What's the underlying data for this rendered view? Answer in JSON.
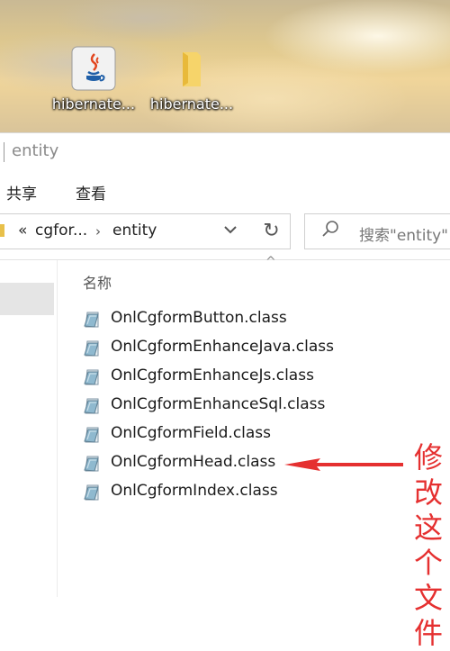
{
  "desktop": {
    "icons": [
      {
        "label": "hibernate...",
        "icon": "java-file-icon"
      },
      {
        "label": "hibernate...",
        "icon": "folder-icon"
      }
    ]
  },
  "window": {
    "title": "entity",
    "ribbon_tabs": [
      "共享",
      "查看"
    ],
    "breadcrumb": {
      "overflow": "«",
      "items": [
        "cgfor...",
        "entity"
      ]
    },
    "search_placeholder": "搜索\"entity\"",
    "column_header": "名称",
    "files": [
      "OnlCgformButton.class",
      "OnlCgformEnhanceJava.class",
      "OnlCgformEnhanceJs.class",
      "OnlCgformEnhanceSql.class",
      "OnlCgformField.class",
      "OnlCgformHead.class",
      "OnlCgformIndex.class"
    ]
  },
  "annotation": {
    "text_chars": [
      "修",
      "改",
      "这",
      "个",
      "文",
      "件"
    ],
    "color": "#e53030"
  }
}
